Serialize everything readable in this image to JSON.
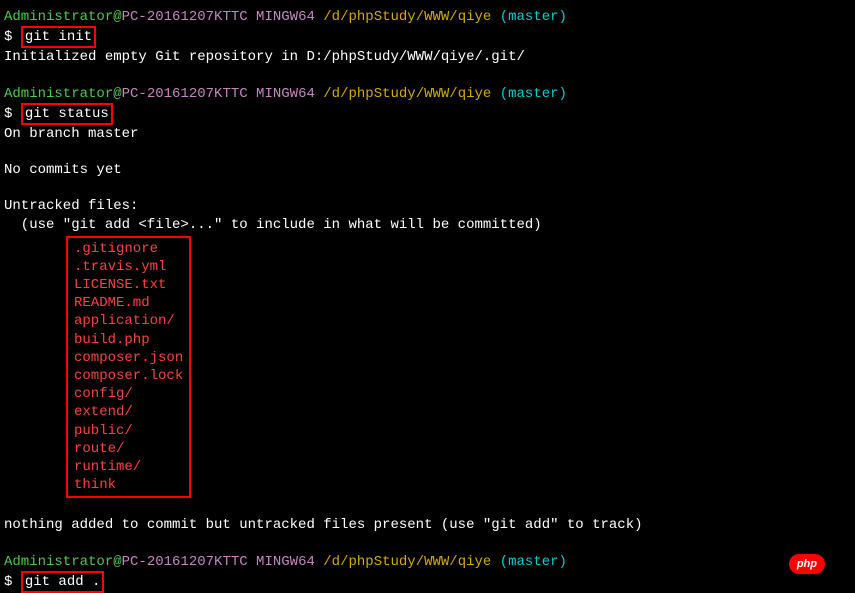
{
  "colors": {
    "user": "#4EC94E",
    "host": "#C586C0",
    "path": "#D4AA00",
    "branch": "#00CED1",
    "untracked": "#FF4040",
    "highlight_border": "#FF0000"
  },
  "prompt": {
    "user": "Administrator",
    "at": "@",
    "host": "PC-20161207KTTC",
    "shell": " MINGW64 ",
    "path": "/d/phpStudy/WWW/qiye",
    "branch": " (master)",
    "dollar": "$ "
  },
  "commands": {
    "cmd1": "git init",
    "cmd2": "git status",
    "cmd3": "git add ."
  },
  "output": {
    "init_result": "Initialized empty Git repository in D:/phpStudy/WWW/qiye/.git/",
    "on_branch": "On branch master",
    "no_commits": "No commits yet",
    "untracked_header": "Untracked files:",
    "untracked_hint": "  (use \"git add <file>...\" to include in what will be committed)",
    "nothing_added": "nothing added to commit but untracked files present (use \"git add\" to track)"
  },
  "untracked_files": {
    "f0": ".gitignore",
    "f1": ".travis.yml",
    "f2": "LICENSE.txt",
    "f3": "README.md",
    "f4": "application/",
    "f5": "build.php",
    "f6": "composer.json",
    "f7": "composer.lock",
    "f8": "config/",
    "f9": "extend/",
    "f10": "public/",
    "f11": "route/",
    "f12": "runtime/",
    "f13": "think"
  },
  "badge": {
    "text": "php"
  }
}
